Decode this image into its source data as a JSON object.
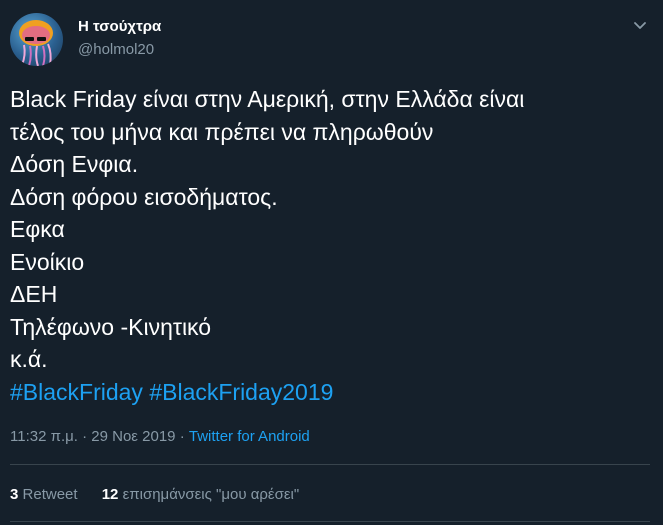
{
  "author": {
    "display_name": "Η τσούχτρα",
    "handle": "@holmol20"
  },
  "icons": {
    "avatar": "jellyfish-avatar",
    "menu": "chevron-down-icon"
  },
  "tweet": {
    "lines": [
      "Black Friday είναι στην Αμερική, στην Ελλάδα είναι",
      "τέλος του μήνα και πρέπει να πληρωθούν",
      "Δόση Ενφια.",
      "Δόση φόρου εισοδήματος.",
      "Εφκα",
      "Ενοίκιο",
      "ΔΕΗ",
      "Τηλέφωνο -Κινητικό",
      "κ.ά."
    ],
    "hashtags": [
      "#BlackFriday",
      "#BlackFriday2019"
    ]
  },
  "meta": {
    "time": "11:32 π.μ.",
    "separator1": " · ",
    "date": "29 Νοε 2019",
    "separator2": " · ",
    "source": "Twitter for Android"
  },
  "stats": {
    "retweet_count": "3",
    "retweet_label": "Retweet",
    "like_count": "12",
    "like_label": "επισημάνσεις \"μου αρέσει\""
  },
  "colors": {
    "background": "#15202b",
    "text": "#ffffff",
    "secondary": "#8899a6",
    "link": "#1da1f2",
    "divider": "#38444d"
  }
}
